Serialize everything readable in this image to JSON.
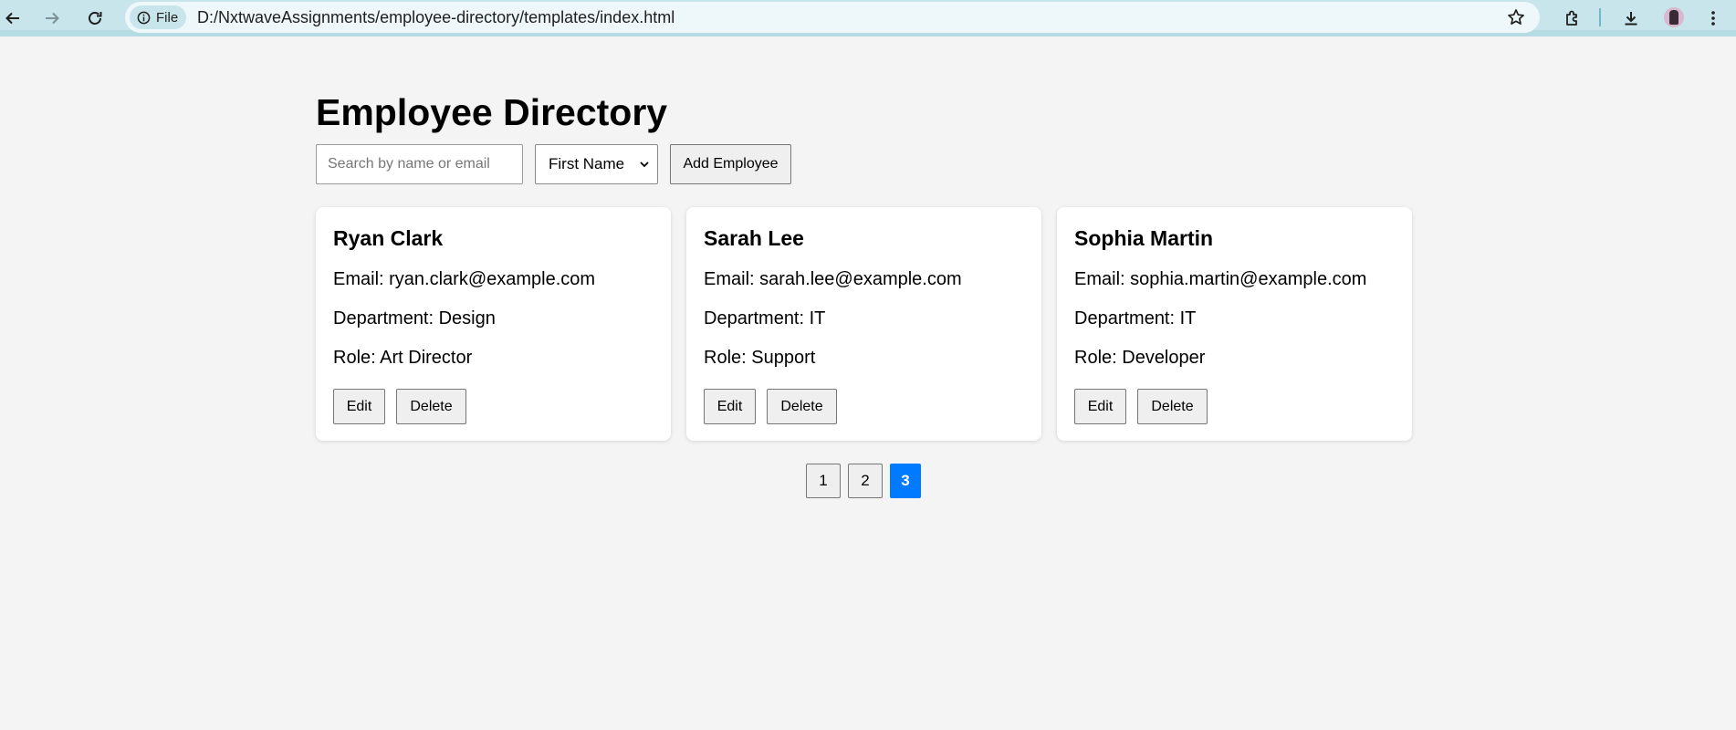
{
  "browser": {
    "site_chip_label": "File",
    "url": "D:/NxtwaveAssignments/employee-directory/templates/index.html"
  },
  "page": {
    "title": "Employee Directory",
    "search_placeholder": "Search by name or email",
    "sort_selected": "First Name",
    "add_button_label": "Add Employee"
  },
  "employees": [
    {
      "name": "Ryan Clark",
      "email": "Email: ryan.clark@example.com",
      "department": "Department: Design",
      "role": "Role: Art Director"
    },
    {
      "name": "Sarah Lee",
      "email": "Email: sarah.lee@example.com",
      "department": "Department: IT",
      "role": "Role: Support"
    },
    {
      "name": "Sophia Martin",
      "email": "Email: sophia.martin@example.com",
      "department": "Department: IT",
      "role": "Role: Developer"
    }
  ],
  "card_actions": {
    "edit_label": "Edit",
    "delete_label": "Delete"
  },
  "pagination": {
    "pages": [
      "1",
      "2",
      "3"
    ],
    "current_page": "3"
  },
  "colors": {
    "toolbar": "#c7e5ea",
    "active_page": "#007bff",
    "page_background": "#f4f4f4"
  }
}
